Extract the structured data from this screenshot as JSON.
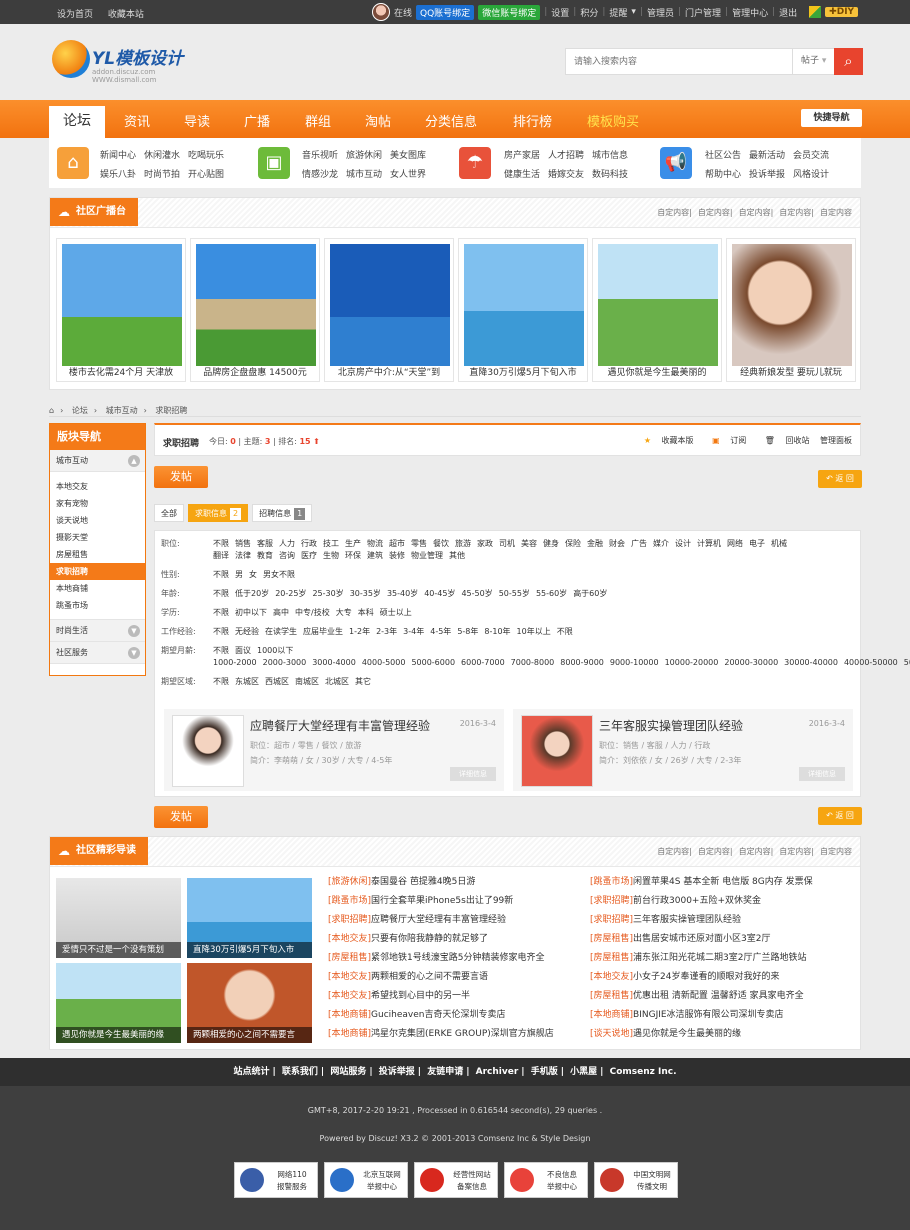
{
  "topbar": {
    "left": [
      "设为首页",
      "收藏本站"
    ],
    "online": "在线",
    "qq": "QQ账号绑定",
    "wechat": "微信账号绑定",
    "links": [
      "设置",
      "积分",
      "提醒",
      "管理员",
      "门户管理",
      "管理中心",
      "退出"
    ],
    "diy": "DIY"
  },
  "logo": {
    "text": "YL模板设计",
    "sub": "addon.discuz.com  WWW.dismall.com"
  },
  "search": {
    "placeholder": "请输入搜索内容",
    "scope": "帖子",
    "icon": "search-icon"
  },
  "nav": {
    "active": "论坛",
    "items": [
      "资讯",
      "导读",
      "广播",
      "群组",
      "淘帖",
      "分类信息",
      "排行榜",
      "模板购买"
    ],
    "quick": "快捷导航"
  },
  "subnav": {
    "groups": [
      {
        "icon": "home-icon",
        "color": "#f6a03a",
        "links": [
          "新闻中心",
          "休闲灌水",
          "吃喝玩乐",
          "娱乐八卦",
          "时尚节拍",
          "开心贴图"
        ]
      },
      {
        "icon": "image-icon",
        "color": "#6dbb3a",
        "links": [
          "音乐视听",
          "旅游休闲",
          "美女图库",
          "情感沙龙",
          "城市互动",
          "女人世界"
        ]
      },
      {
        "icon": "umbrella-icon",
        "color": "#e8523a",
        "links": [
          "房产家居",
          "人才招聘",
          "城市信息",
          "健康生活",
          "婚嫁交友",
          "数码科技"
        ]
      },
      {
        "icon": "megaphone-icon",
        "color": "#3a8ee8",
        "links": [
          "社区公告",
          "最新活动",
          "会员交流",
          "帮助中心",
          "投诉举报",
          "风格设计"
        ]
      }
    ]
  },
  "broadcast": {
    "title": "社区广播台",
    "links": [
      "自定内容",
      "自定内容",
      "自定内容",
      "自定内容",
      "自定内容"
    ],
    "cards": [
      {
        "caption": "楼市去化需24个月 天津放"
      },
      {
        "caption": "品牌房企盘盘惠 14500元"
      },
      {
        "caption": "北京房产中介:从“天堂”到"
      },
      {
        "caption": "直降30万引爆5月下旬入市"
      },
      {
        "caption": "遇见你就是今生最美丽的"
      },
      {
        "caption": "经典新娘发型 要玩儿就玩"
      }
    ]
  },
  "breadcrumb": [
    "论坛",
    "城市互动",
    "求职招聘"
  ],
  "sidebar": {
    "title": "版块导航",
    "groups": [
      {
        "name": "城市互动",
        "items": [
          "本地交友",
          "家有宠物",
          "谈天说地",
          "摄影天堂",
          "房屋租售",
          "求职招聘",
          "本地商铺",
          "跳蚤市场"
        ]
      },
      {
        "name": "时尚生活",
        "items": []
      },
      {
        "name": "社区服务",
        "items": []
      }
    ],
    "active": "求职招聘"
  },
  "forum": {
    "name": "求职招聘",
    "today_label": "今日:",
    "today": "0",
    "topics_label": "主题:",
    "topics": "3",
    "rank_label": "排名:",
    "rank": "15",
    "actions": [
      "收藏本版",
      "订阅",
      "回收站",
      "管理面板"
    ]
  },
  "buttons": {
    "post": "发帖",
    "back": "返 回"
  },
  "tabs": [
    {
      "label": "全部"
    },
    {
      "label": "求职信息",
      "count": "2"
    },
    {
      "label": "招聘信息",
      "count": "1"
    }
  ],
  "filters": [
    {
      "label": "职位:",
      "options": [
        "不限",
        "销售",
        "客服",
        "人力",
        "行政",
        "技工",
        "生产",
        "物流",
        "超市",
        "零售",
        "餐饮",
        "旅游",
        "家政",
        "司机",
        "美容",
        "健身",
        "保险",
        "金融",
        "财会",
        "广告",
        "媒介",
        "设计",
        "计算机",
        "网络",
        "电子",
        "机械",
        "翻译",
        "法律",
        "教育",
        "咨询",
        "医疗",
        "生物",
        "环保",
        "建筑",
        "装修",
        "物业管理",
        "其他"
      ]
    },
    {
      "label": "性别:",
      "options": [
        "不限",
        "男",
        "女",
        "男女不限"
      ]
    },
    {
      "label": "年龄:",
      "options": [
        "不限",
        "低于20岁",
        "20-25岁",
        "25-30岁",
        "30-35岁",
        "35-40岁",
        "40-45岁",
        "45-50岁",
        "50-55岁",
        "55-60岁",
        "高于60岁"
      ]
    },
    {
      "label": "学历:",
      "options": [
        "不限",
        "初中以下",
        "高中",
        "中专/技校",
        "大专",
        "本科",
        "硕士以上"
      ]
    },
    {
      "label": "工作经验:",
      "options": [
        "不限",
        "无经验",
        "在读学生",
        "应届毕业生",
        "1-2年",
        "2-3年",
        "3-4年",
        "4-5年",
        "5-8年",
        "8-10年",
        "10年以上",
        "不限"
      ]
    },
    {
      "label": "期望月薪:",
      "options": [
        "不限",
        "面议",
        "1000以下",
        "1000-2000",
        "2000-3000",
        "3000-4000",
        "4000-5000",
        "5000-6000",
        "6000-7000",
        "7000-8000",
        "8000-9000",
        "9000-10000",
        "10000-20000",
        "20000-30000",
        "30000-40000",
        "40000-50000",
        "50000以上"
      ]
    },
    {
      "label": "期望区域:",
      "options": [
        "不限",
        "东城区",
        "西城区",
        "南城区",
        "北城区",
        "其它"
      ]
    }
  ],
  "jobs": [
    {
      "title": "应聘餐厅大堂经理有丰富管理经验",
      "date": "2016-3-4",
      "line1": "职位：超市 / 零售 / 餐饮 / 旅游",
      "line2": "简介：李萌萌 / 女 / 30岁 / 大专 / 4-5年",
      "detail": "详细信息"
    },
    {
      "title": "三年客服实操管理团队经验",
      "date": "2016-3-4",
      "line1": "职位：销售 / 客服 / 人力 / 行政",
      "line2": "简介：刘依依 / 女 / 26岁 / 大专 / 2-3年",
      "detail": "详细信息"
    }
  ],
  "guide": {
    "title": "社区精彩导读",
    "links": [
      "自定内容",
      "自定内容",
      "自定内容",
      "自定内容",
      "自定内容"
    ],
    "pics": [
      {
        "caption": "爱情只不过是一个没有策划"
      },
      {
        "caption": "直降30万引爆5月下旬入市"
      },
      {
        "caption": "遇见你就是今生最美丽的缘"
      },
      {
        "caption": "两颗相爱的心之间不需要言"
      }
    ],
    "col1": [
      {
        "tag": "[旅游休闲]",
        "text": "泰国曼谷 芭提雅4晚5日游"
      },
      {
        "tag": "[跳蚤市场]",
        "text": "国行全套苹果iPhone5s出让了99新"
      },
      {
        "tag": "[求职招聘]",
        "text": "应聘餐厅大堂经理有丰富管理经验"
      },
      {
        "tag": "[本地交友]",
        "text": "只要有你陪我静静的就足够了"
      },
      {
        "tag": "[房屋租售]",
        "text": "紧邻地铁1号线濠宝路5分钟精装修家电齐全"
      },
      {
        "tag": "[本地交友]",
        "text": "两颗相爱的心之间不需要言语"
      },
      {
        "tag": "[本地交友]",
        "text": "希望找到心目中的另一半"
      },
      {
        "tag": "[本地商铺]",
        "text": "Guciheaven吉奇天伦深圳专卖店"
      },
      {
        "tag": "[本地商铺]",
        "text": "鸿星尔克集团(ERKE GROUP)深圳官方旗舰店"
      }
    ],
    "col2": [
      {
        "tag": "[跳蚤市场]",
        "text": "闲置苹果4S 基本全新 电信版 8G内存 发票保"
      },
      {
        "tag": "[求职招聘]",
        "text": "前台行政3000+五险+双休奖金"
      },
      {
        "tag": "[求职招聘]",
        "text": "三年客服实操管理团队经验"
      },
      {
        "tag": "[房屋租售]",
        "text": "出售居安城市还原对面小区3室2厅"
      },
      {
        "tag": "[房屋租售]",
        "text": "浦东张江阳光花城二期3室2厅广兰路地铁站"
      },
      {
        "tag": "[本地交友]",
        "text": "小女子24岁奉谨看的顺眼对我好的来"
      },
      {
        "tag": "[房屋租售]",
        "text": "优惠出租 清新配置 温馨舒适 家具家电齐全"
      },
      {
        "tag": "[本地商铺]",
        "text": "BINGJIE冰洁服饰有限公司深圳专卖店"
      },
      {
        "tag": "[谈天说地]",
        "text": "遇见你就是今生最美丽的缘"
      }
    ]
  },
  "footer": {
    "links": [
      "站点统计",
      "联系我们",
      "网站服务",
      "投诉举报",
      "友链申请",
      "Archiver",
      "手机版",
      "小黑屋",
      "Comsenz Inc."
    ],
    "stats": "GMT+8, 2017-2-20 19:21 , Processed in 0.616544 second(s), 29 queries .",
    "powered": "Powered by Discuz! X3.2 © 2001-2013 Comsenz Inc & Style Design",
    "badges": [
      {
        "l1": "网络110",
        "l2": "报警服务"
      },
      {
        "l1": "北京互联网",
        "l2": "举报中心"
      },
      {
        "l1": "经营性网站",
        "l2": "备案信息"
      },
      {
        "l1": "不良信息",
        "l2": "举报中心"
      },
      {
        "l1": "中国文明网",
        "l2": "传播文明"
      }
    ]
  }
}
